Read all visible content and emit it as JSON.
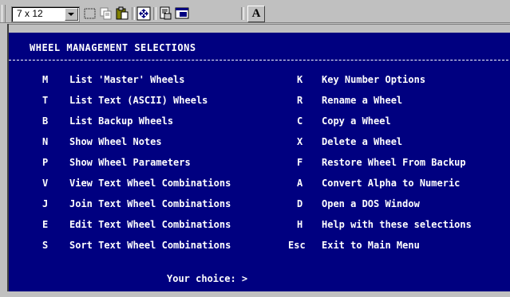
{
  "toolbar": {
    "font_size": "7 x 12",
    "buttons": [
      {
        "name": "select-icon"
      },
      {
        "name": "copy-icon"
      },
      {
        "name": "paste-icon"
      },
      {
        "name": "fullscreen-icon"
      },
      {
        "name": "properties-icon"
      },
      {
        "name": "background-icon"
      }
    ],
    "font_button_label": "A"
  },
  "screen": {
    "title": "WHEEL MANAGEMENT SELECTIONS",
    "left_menu": [
      {
        "key": "M",
        "label": "List 'Master' Wheels"
      },
      {
        "key": "T",
        "label": "List Text (ASCII) Wheels"
      },
      {
        "key": "B",
        "label": "List Backup Wheels"
      },
      {
        "key": "N",
        "label": "Show Wheel Notes"
      },
      {
        "key": "P",
        "label": "Show Wheel Parameters"
      },
      {
        "key": "V",
        "label": "View Text Wheel Combinations"
      },
      {
        "key": "J",
        "label": "Join Text Wheel Combinations"
      },
      {
        "key": "E",
        "label": "Edit Text Wheel Combinations"
      },
      {
        "key": "S",
        "label": "Sort Text Wheel Combinations"
      }
    ],
    "right_menu": [
      {
        "key": "K",
        "label": "Key Number Options"
      },
      {
        "key": "R",
        "label": "Rename a Wheel"
      },
      {
        "key": "C",
        "label": "Copy a Wheel"
      },
      {
        "key": "X",
        "label": "Delete a Wheel"
      },
      {
        "key": "F",
        "label": "Restore Wheel From Backup"
      },
      {
        "key": "A",
        "label": "Convert Alpha to Numeric"
      },
      {
        "key": "D",
        "label": "Open a DOS Window"
      },
      {
        "key": "H",
        "label": "Help with these selections"
      },
      {
        "key": "Esc",
        "label": "Exit to Main Menu"
      }
    ],
    "prompt": "Your choice: >"
  },
  "colors": {
    "screen_bg": "#000080",
    "screen_fg": "#ffffff",
    "chrome": "#c0c0c0"
  }
}
